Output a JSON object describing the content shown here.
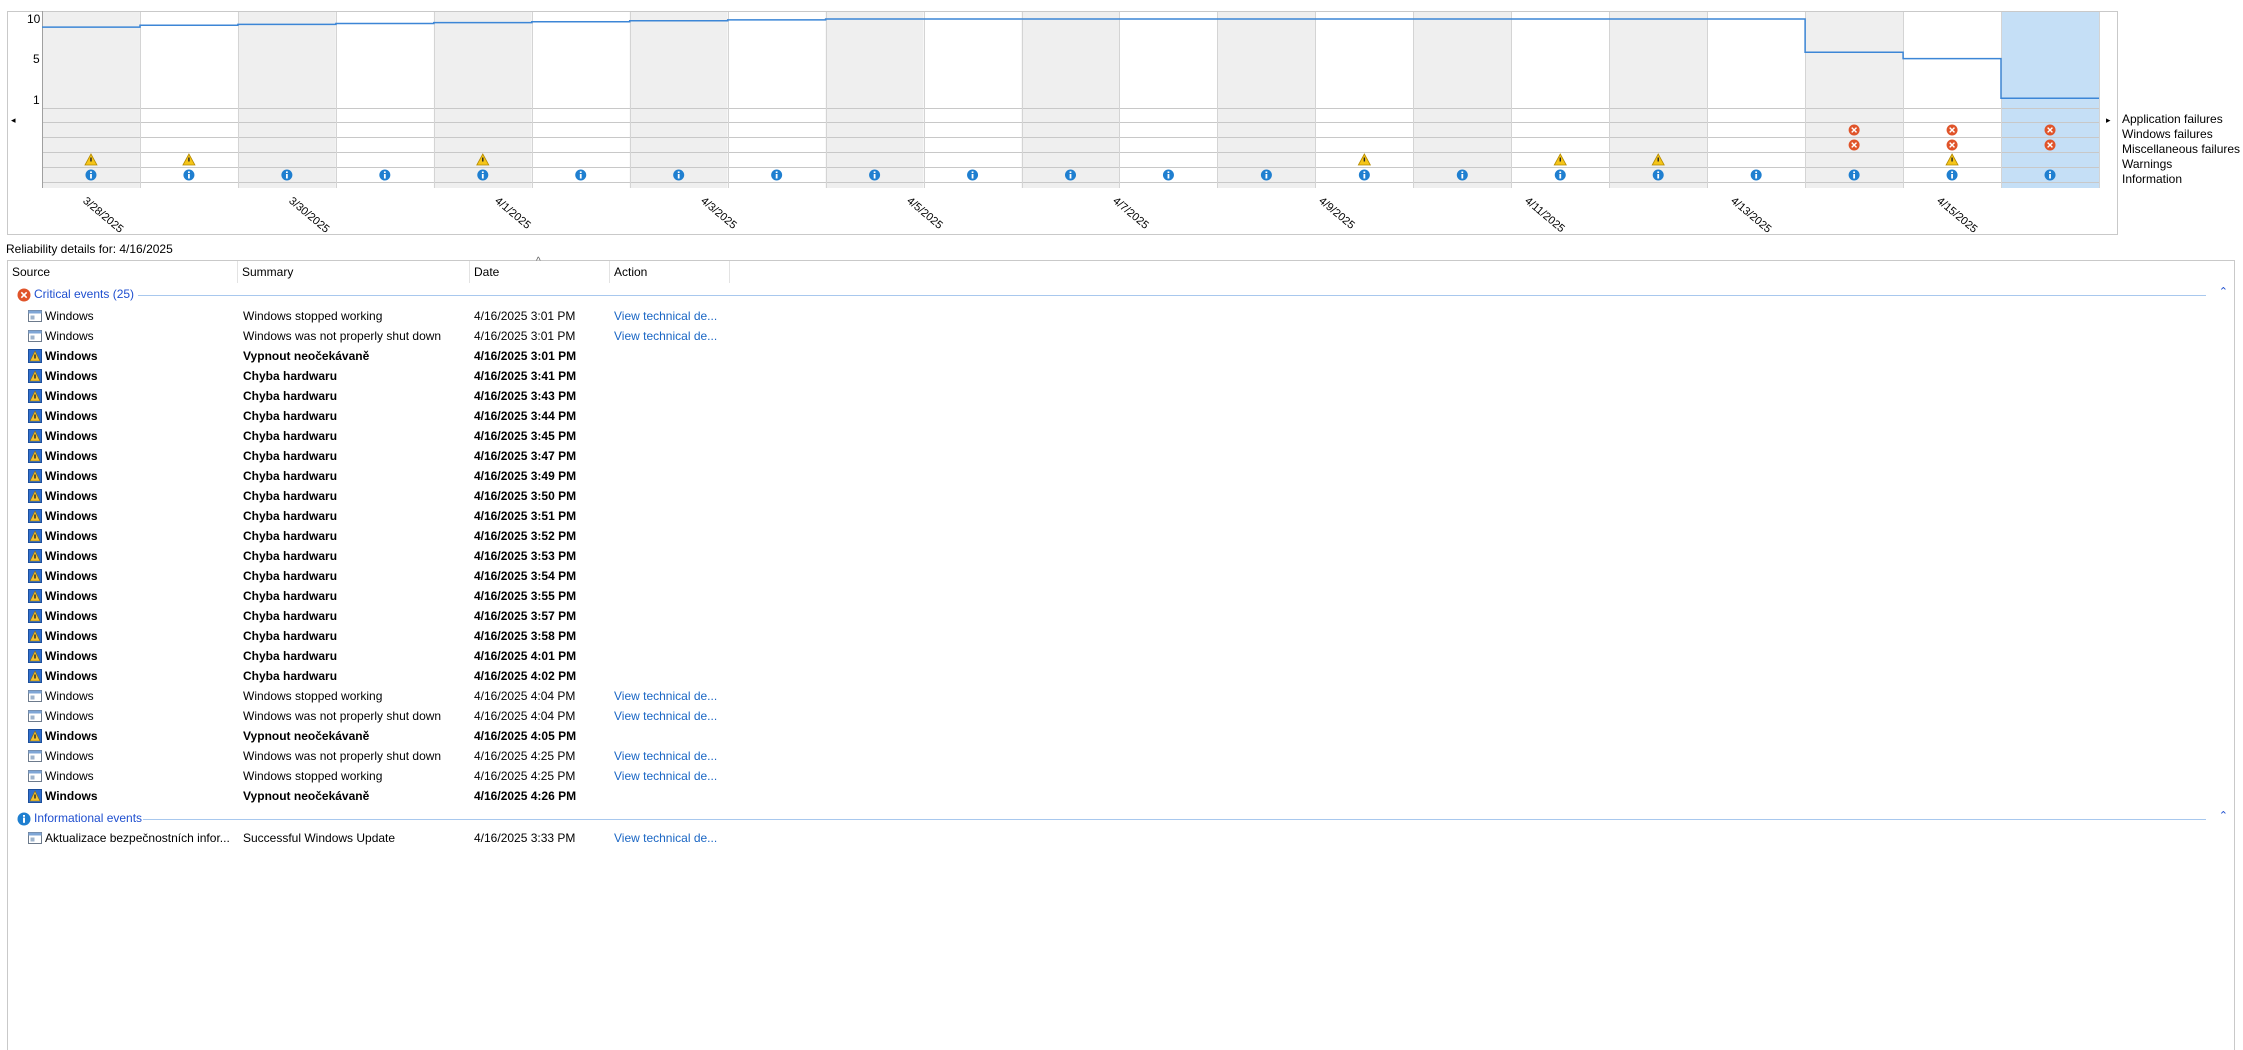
{
  "chart": {
    "y_ticks": [
      "10",
      "5",
      "1"
    ],
    "row_labels": [
      "Application failures",
      "Windows failures",
      "Miscellaneous failures",
      "Warnings",
      "Information"
    ],
    "date_labels": [
      "3/28/2025",
      "3/30/2025",
      "4/1/2025",
      "4/3/2025",
      "4/5/2025",
      "4/7/2025",
      "4/9/2025",
      "4/11/2025",
      "4/13/2025",
      "4/15/2025"
    ],
    "nav_left": "◂",
    "nav_right": "▸",
    "line_color": "#3c86d6",
    "selected_color": "#c5dff6"
  },
  "chart_data": {
    "type": "line",
    "title": "",
    "xlabel": "",
    "ylabel": "",
    "ylim": [
      1,
      10
    ],
    "x": [
      "3/27/2025",
      "3/28/2025",
      "3/29/2025",
      "3/30/2025",
      "3/31/2025",
      "4/1/2025",
      "4/2/2025",
      "4/3/2025",
      "4/4/2025",
      "4/5/2025",
      "4/6/2025",
      "4/7/2025",
      "4/8/2025",
      "4/9/2025",
      "4/10/2025",
      "4/11/2025",
      "4/12/2025",
      "4/13/2025",
      "4/14/2025",
      "4/15/2025",
      "4/16/2025"
    ],
    "series": [
      {
        "values": [
          9.1,
          9.3,
          9.4,
          9.5,
          9.6,
          9.7,
          9.8,
          9.9,
          10,
          10,
          10,
          10,
          10,
          10,
          10,
          10,
          10,
          10,
          6.3,
          5.6,
          1.2
        ]
      }
    ],
    "event_rows": {
      "Application failures": [],
      "Windows failures": [
        "4/14/2025",
        "4/15/2025",
        "4/16/2025"
      ],
      "Miscellaneous failures": [
        "4/14/2025",
        "4/15/2025",
        "4/16/2025"
      ],
      "Warnings": [
        "3/27/2025",
        "3/28/2025",
        "3/31/2025",
        "4/9/2025",
        "4/11/2025",
        "4/12/2025",
        "4/15/2025"
      ],
      "Information": [
        "3/27/2025",
        "3/28/2025",
        "3/29/2025",
        "3/30/2025",
        "3/31/2025",
        "4/1/2025",
        "4/2/2025",
        "4/3/2025",
        "4/4/2025",
        "4/5/2025",
        "4/6/2025",
        "4/7/2025",
        "4/8/2025",
        "4/9/2025",
        "4/10/2025",
        "4/11/2025",
        "4/12/2025",
        "4/13/2025",
        "4/14/2025",
        "4/15/2025",
        "4/16/2025"
      ]
    },
    "selected": "4/16/2025",
    "grid": true
  },
  "details": {
    "caption": "Reliability details for: 4/16/2025",
    "columns": [
      "Source",
      "Summary",
      "Date",
      "Action"
    ],
    "sort_indicator": "^",
    "critical_title": "Critical events (25)",
    "info_title": "Informational events",
    "collapse_glyph": "⌃",
    "critical_rows": [
      {
        "source": "Windows",
        "summary": "Windows stopped working",
        "date": "4/16/2025 3:01 PM",
        "action": "View technical de...",
        "bold": false
      },
      {
        "source": "Windows",
        "summary": "Windows was not properly shut down",
        "date": "4/16/2025 3:01 PM",
        "action": "View technical de...",
        "bold": false
      },
      {
        "source": "Windows",
        "summary": "Vypnout neočekávaně",
        "date": "4/16/2025 3:01 PM",
        "action": "",
        "bold": true
      },
      {
        "source": "Windows",
        "summary": "Chyba hardwaru",
        "date": "4/16/2025 3:41 PM",
        "action": "",
        "bold": true
      },
      {
        "source": "Windows",
        "summary": "Chyba hardwaru",
        "date": "4/16/2025 3:43 PM",
        "action": "",
        "bold": true
      },
      {
        "source": "Windows",
        "summary": "Chyba hardwaru",
        "date": "4/16/2025 3:44 PM",
        "action": "",
        "bold": true
      },
      {
        "source": "Windows",
        "summary": "Chyba hardwaru",
        "date": "4/16/2025 3:45 PM",
        "action": "",
        "bold": true
      },
      {
        "source": "Windows",
        "summary": "Chyba hardwaru",
        "date": "4/16/2025 3:47 PM",
        "action": "",
        "bold": true
      },
      {
        "source": "Windows",
        "summary": "Chyba hardwaru",
        "date": "4/16/2025 3:49 PM",
        "action": "",
        "bold": true
      },
      {
        "source": "Windows",
        "summary": "Chyba hardwaru",
        "date": "4/16/2025 3:50 PM",
        "action": "",
        "bold": true
      },
      {
        "source": "Windows",
        "summary": "Chyba hardwaru",
        "date": "4/16/2025 3:51 PM",
        "action": "",
        "bold": true
      },
      {
        "source": "Windows",
        "summary": "Chyba hardwaru",
        "date": "4/16/2025 3:52 PM",
        "action": "",
        "bold": true
      },
      {
        "source": "Windows",
        "summary": "Chyba hardwaru",
        "date": "4/16/2025 3:53 PM",
        "action": "",
        "bold": true
      },
      {
        "source": "Windows",
        "summary": "Chyba hardwaru",
        "date": "4/16/2025 3:54 PM",
        "action": "",
        "bold": true
      },
      {
        "source": "Windows",
        "summary": "Chyba hardwaru",
        "date": "4/16/2025 3:55 PM",
        "action": "",
        "bold": true
      },
      {
        "source": "Windows",
        "summary": "Chyba hardwaru",
        "date": "4/16/2025 3:57 PM",
        "action": "",
        "bold": true
      },
      {
        "source": "Windows",
        "summary": "Chyba hardwaru",
        "date": "4/16/2025 3:58 PM",
        "action": "",
        "bold": true
      },
      {
        "source": "Windows",
        "summary": "Chyba hardwaru",
        "date": "4/16/2025 4:01 PM",
        "action": "",
        "bold": true
      },
      {
        "source": "Windows",
        "summary": "Chyba hardwaru",
        "date": "4/16/2025 4:02 PM",
        "action": "",
        "bold": true
      },
      {
        "source": "Windows",
        "summary": "Windows stopped working",
        "date": "4/16/2025 4:04 PM",
        "action": "View technical de...",
        "bold": false
      },
      {
        "source": "Windows",
        "summary": "Windows was not properly shut down",
        "date": "4/16/2025 4:04 PM",
        "action": "View technical de...",
        "bold": false
      },
      {
        "source": "Windows",
        "summary": "Vypnout neočekávaně",
        "date": "4/16/2025 4:05 PM",
        "action": "",
        "bold": true
      },
      {
        "source": "Windows",
        "summary": "Windows was not properly shut down",
        "date": "4/16/2025 4:25 PM",
        "action": "View technical de...",
        "bold": false
      },
      {
        "source": "Windows",
        "summary": "Windows stopped working",
        "date": "4/16/2025 4:25 PM",
        "action": "View technical de...",
        "bold": false
      },
      {
        "source": "Windows",
        "summary": "Vypnout neočekávaně",
        "date": "4/16/2025 4:26 PM",
        "action": "",
        "bold": true
      }
    ],
    "info_rows": [
      {
        "source": "Aktualizace bezpečnostních infor...",
        "summary": "Successful Windows Update",
        "date": "4/16/2025 3:33 PM",
        "action": "View technical de...",
        "bold": false
      }
    ]
  }
}
